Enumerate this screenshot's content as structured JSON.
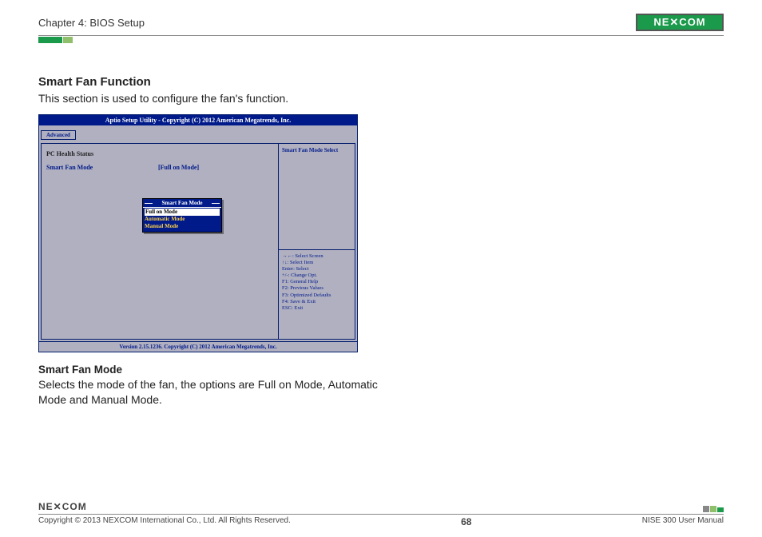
{
  "header": {
    "chapter": "Chapter 4: BIOS Setup",
    "logo_text": "NE✕COM"
  },
  "section": {
    "title": "Smart Fan Function",
    "description": "This section is used to configure the fan's function."
  },
  "bios": {
    "title": "Aptio Setup Utility - Copyright (C) 2012 American Megatrends, Inc.",
    "tab": "Advanced",
    "health_label": "PC Health Status",
    "mode_label": "Smart Fan Mode",
    "mode_value": "[Full on Mode]",
    "help_title": "Smart Fan Mode Select",
    "popup_title": "Smart Fan Mode",
    "popup_options": {
      "o0": "Full on Mode",
      "o1": "Automatic Mode",
      "o2": "Manual Mode"
    },
    "keys": {
      "k0": "→←: Select Screen",
      "k1": "↑↓: Select Item",
      "k2": "Enter: Select",
      "k3": "+/-: Change Opt.",
      "k4": "F1: General Help",
      "k5": "F2: Previous Values",
      "k6": "F3: Optimized Defaults",
      "k7": "F4: Save & Exit",
      "k8": "ESC: Exit"
    },
    "footer": "Version 2.15.1236. Copyright (C) 2012 American Megatrends, Inc."
  },
  "subsection": {
    "heading": "Smart Fan Mode",
    "body": "Selects the mode of the fan, the options are Full on Mode, Automatic Mode and Manual Mode."
  },
  "footer": {
    "logo": "NE✕COM",
    "copyright": "Copyright © 2013 NEXCOM International Co., Ltd. All Rights Reserved.",
    "page_num": "68",
    "manual": "NISE 300 User Manual"
  }
}
